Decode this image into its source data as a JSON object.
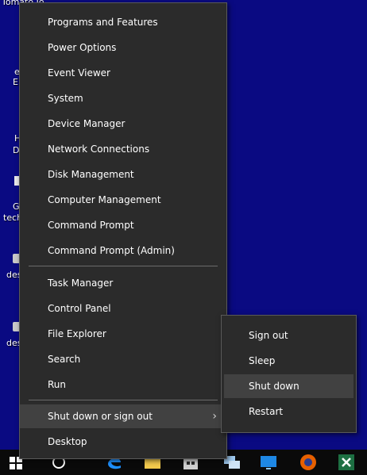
{
  "desktop": {
    "labels": [
      "Tomato Jo",
      "e",
      "E",
      "H",
      "D",
      "G",
      "tech",
      "des",
      "des"
    ]
  },
  "main_menu": {
    "group1": [
      "Programs and Features",
      "Power Options",
      "Event Viewer",
      "System",
      "Device Manager",
      "Network Connections",
      "Disk Management",
      "Computer Management",
      "Command Prompt",
      "Command Prompt (Admin)"
    ],
    "group2": [
      "Task Manager",
      "Control Panel",
      "File Explorer",
      "Search",
      "Run"
    ],
    "shutdown_label": "Shut down or sign out",
    "desktop_label": "Desktop"
  },
  "sub_menu": {
    "items": [
      "Sign out",
      "Sleep",
      "Shut down",
      "Restart"
    ],
    "highlighted": "Shut down"
  },
  "taskbar": {
    "icons": [
      "windows-start-icon",
      "cortana-icon",
      "edge-icon",
      "file-explorer-icon",
      "store-icon",
      "network-icon",
      "monitor-icon",
      "firefox-icon",
      "excel-icon"
    ]
  },
  "colors": {
    "desktop_bg": "#0a0a82",
    "menu_bg": "#2b2b2b",
    "highlight": "#414141",
    "taskbar_bg": "#0a0a0a"
  }
}
